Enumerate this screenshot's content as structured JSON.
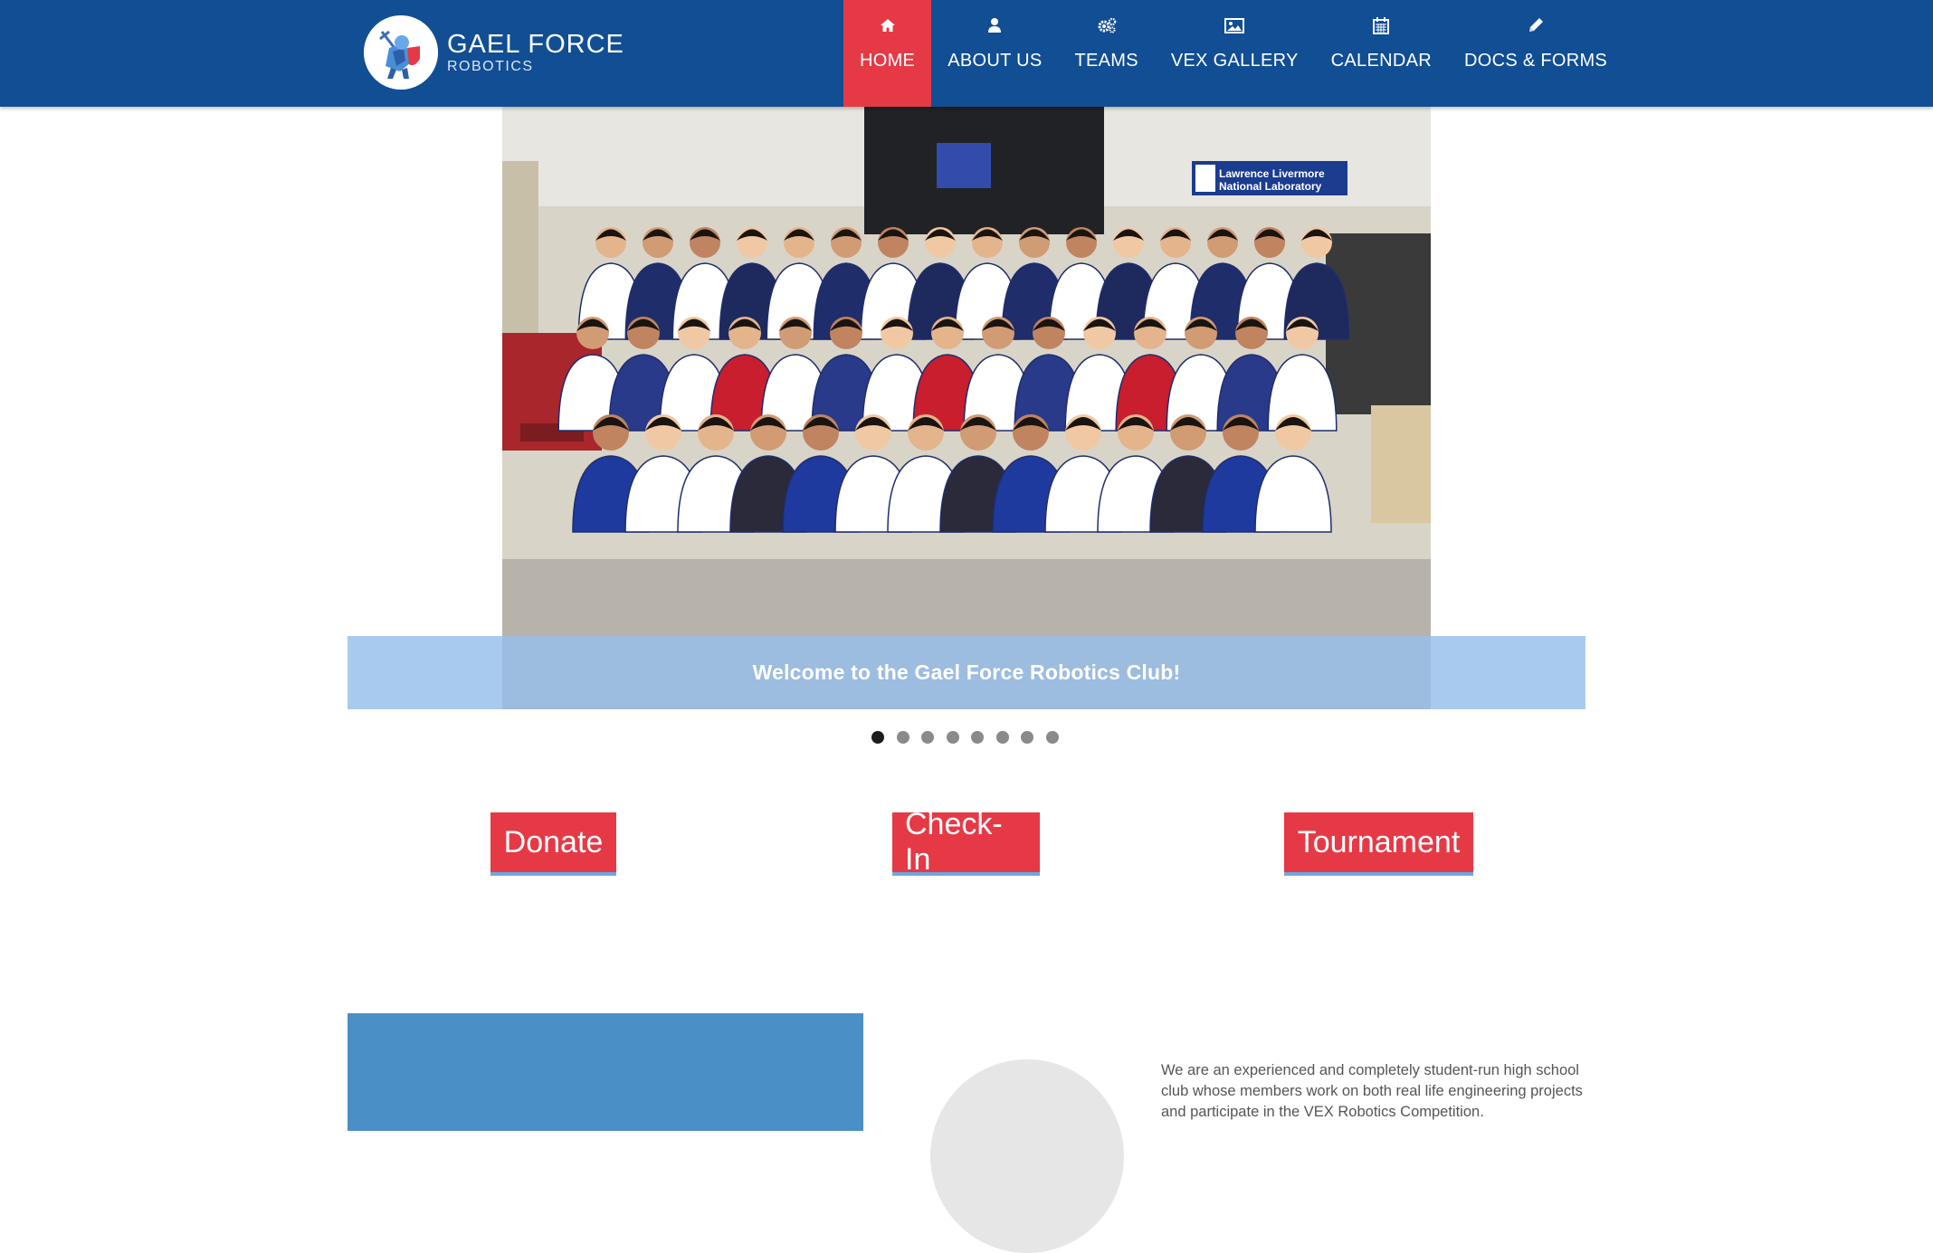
{
  "header": {
    "logo": {
      "title": "GAEL FORCE",
      "subtitle": "ROBOTICS",
      "icon": "knight-mascot-icon"
    },
    "nav": [
      {
        "label": "HOME",
        "icon": "home-icon",
        "active": true
      },
      {
        "label": "ABOUT US",
        "icon": "user-icon",
        "active": false
      },
      {
        "label": "TEAMS",
        "icon": "gears-icon",
        "active": false
      },
      {
        "label": "VEX GALLERY",
        "icon": "picture-icon",
        "active": false
      },
      {
        "label": "CALENDAR",
        "icon": "calendar-icon",
        "active": false
      },
      {
        "label": "DOCS & FORMS",
        "icon": "pencil-icon",
        "active": false
      }
    ]
  },
  "carousel": {
    "caption": "Welcome to the Gael Force Robotics Club!",
    "sign_line1": "Lawrence Livermore",
    "sign_line2": "National Laboratory",
    "slide_count": 8,
    "active_slide": 1
  },
  "actions": {
    "donate": "Donate",
    "checkin": "Check-In",
    "tournament": "Tournament"
  },
  "about": {
    "text": "We are an experienced and completely student-run high school club whose members work on both real life engineering projects and participate in the VEX Robotics Competition."
  },
  "colors": {
    "header_bg": "#114e94",
    "accent_red": "#e63946",
    "caption_band": "#96beec",
    "panel_blue": "#4a8fc6"
  }
}
